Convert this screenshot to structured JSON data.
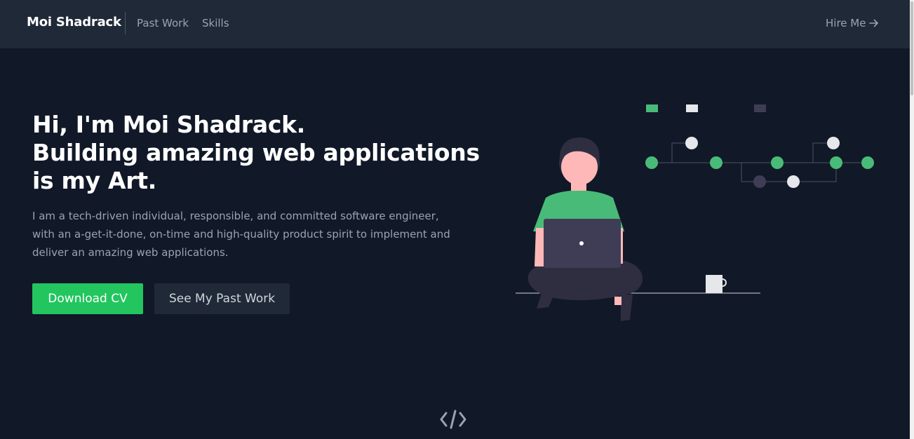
{
  "navbar": {
    "brand": "Moi Shadrack",
    "links": [
      {
        "label": "Past Work"
      },
      {
        "label": "Skills"
      }
    ],
    "cta_label": "Hire Me"
  },
  "hero": {
    "heading_lines": [
      "Hi, I'm Moi Shadrack.",
      "Building amazing web applications",
      "is my Art."
    ],
    "description": "I am a tech-driven individual, responsible, and committed software engineer, with an a-get-it-done, on-time and high-quality product spirit to implement and deliver an amazing web applications.",
    "primary_button": "Download CV",
    "secondary_button": "See My Past Work"
  },
  "icons": {
    "hire_arrow": "arrow-right-icon",
    "footer": "code-icon"
  },
  "colors": {
    "background": "#111827",
    "navbar": "#1f2937",
    "accent": "#22c55e",
    "illustration_green": "#48bb78",
    "muted_text": "#9ca3af"
  }
}
